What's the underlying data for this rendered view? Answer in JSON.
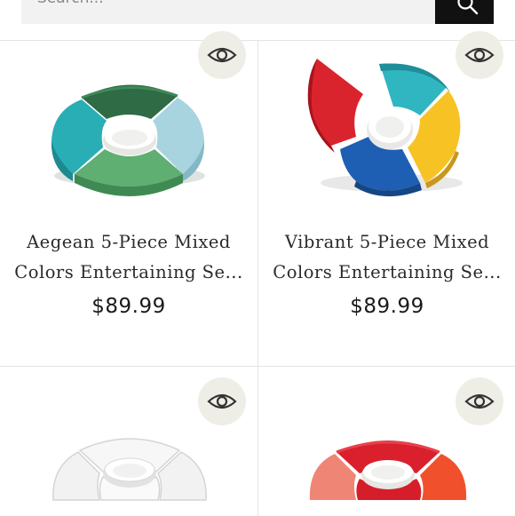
{
  "search": {
    "placeholder": "Search..."
  },
  "products": [
    {
      "title_line1": "Aegean 5-Piece Mixed",
      "title_line2": "Colors Entertaining Se...",
      "price": "$89.99"
    },
    {
      "title_line1": "Vibrant 5-Piece Mixed",
      "title_line2": "Colors Entertaining Se...",
      "price": "$89.99"
    },
    {},
    {}
  ],
  "icons": {
    "search": "search-icon",
    "quick_view": "eye-icon"
  },
  "colors": {
    "search_button": "#111111",
    "quick_view_bg": "#efeee6",
    "divider": "#e4e4e4"
  }
}
